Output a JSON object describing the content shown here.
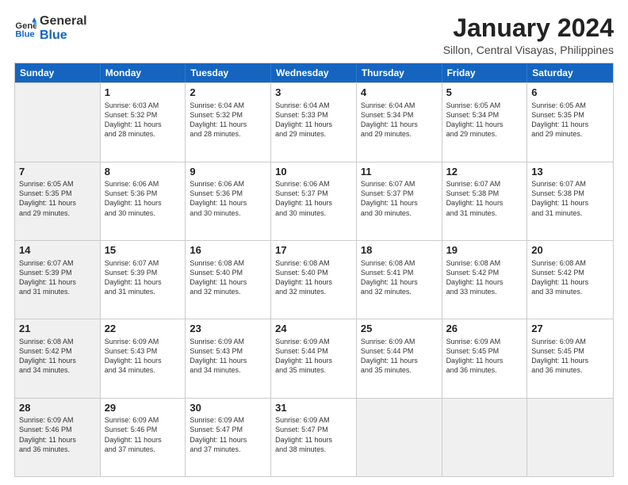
{
  "logo": {
    "text_general": "General",
    "text_blue": "Blue"
  },
  "header": {
    "title": "January 2024",
    "subtitle": "Sillon, Central Visayas, Philippines"
  },
  "weekdays": [
    "Sunday",
    "Monday",
    "Tuesday",
    "Wednesday",
    "Thursday",
    "Friday",
    "Saturday"
  ],
  "rows": [
    [
      {
        "day": "",
        "lines": [],
        "shaded": true
      },
      {
        "day": "1",
        "lines": [
          "Sunrise: 6:03 AM",
          "Sunset: 5:32 PM",
          "Daylight: 11 hours",
          "and 28 minutes."
        ]
      },
      {
        "day": "2",
        "lines": [
          "Sunrise: 6:04 AM",
          "Sunset: 5:32 PM",
          "Daylight: 11 hours",
          "and 28 minutes."
        ]
      },
      {
        "day": "3",
        "lines": [
          "Sunrise: 6:04 AM",
          "Sunset: 5:33 PM",
          "Daylight: 11 hours",
          "and 29 minutes."
        ]
      },
      {
        "day": "4",
        "lines": [
          "Sunrise: 6:04 AM",
          "Sunset: 5:34 PM",
          "Daylight: 11 hours",
          "and 29 minutes."
        ]
      },
      {
        "day": "5",
        "lines": [
          "Sunrise: 6:05 AM",
          "Sunset: 5:34 PM",
          "Daylight: 11 hours",
          "and 29 minutes."
        ]
      },
      {
        "day": "6",
        "lines": [
          "Sunrise: 6:05 AM",
          "Sunset: 5:35 PM",
          "Daylight: 11 hours",
          "and 29 minutes."
        ]
      }
    ],
    [
      {
        "day": "7",
        "lines": [
          "Sunrise: 6:05 AM",
          "Sunset: 5:35 PM",
          "Daylight: 11 hours",
          "and 29 minutes."
        ],
        "shaded": true
      },
      {
        "day": "8",
        "lines": [
          "Sunrise: 6:06 AM",
          "Sunset: 5:36 PM",
          "Daylight: 11 hours",
          "and 30 minutes."
        ]
      },
      {
        "day": "9",
        "lines": [
          "Sunrise: 6:06 AM",
          "Sunset: 5:36 PM",
          "Daylight: 11 hours",
          "and 30 minutes."
        ]
      },
      {
        "day": "10",
        "lines": [
          "Sunrise: 6:06 AM",
          "Sunset: 5:37 PM",
          "Daylight: 11 hours",
          "and 30 minutes."
        ]
      },
      {
        "day": "11",
        "lines": [
          "Sunrise: 6:07 AM",
          "Sunset: 5:37 PM",
          "Daylight: 11 hours",
          "and 30 minutes."
        ]
      },
      {
        "day": "12",
        "lines": [
          "Sunrise: 6:07 AM",
          "Sunset: 5:38 PM",
          "Daylight: 11 hours",
          "and 31 minutes."
        ]
      },
      {
        "day": "13",
        "lines": [
          "Sunrise: 6:07 AM",
          "Sunset: 5:38 PM",
          "Daylight: 11 hours",
          "and 31 minutes."
        ]
      }
    ],
    [
      {
        "day": "14",
        "lines": [
          "Sunrise: 6:07 AM",
          "Sunset: 5:39 PM",
          "Daylight: 11 hours",
          "and 31 minutes."
        ],
        "shaded": true
      },
      {
        "day": "15",
        "lines": [
          "Sunrise: 6:07 AM",
          "Sunset: 5:39 PM",
          "Daylight: 11 hours",
          "and 31 minutes."
        ]
      },
      {
        "day": "16",
        "lines": [
          "Sunrise: 6:08 AM",
          "Sunset: 5:40 PM",
          "Daylight: 11 hours",
          "and 32 minutes."
        ]
      },
      {
        "day": "17",
        "lines": [
          "Sunrise: 6:08 AM",
          "Sunset: 5:40 PM",
          "Daylight: 11 hours",
          "and 32 minutes."
        ]
      },
      {
        "day": "18",
        "lines": [
          "Sunrise: 6:08 AM",
          "Sunset: 5:41 PM",
          "Daylight: 11 hours",
          "and 32 minutes."
        ]
      },
      {
        "day": "19",
        "lines": [
          "Sunrise: 6:08 AM",
          "Sunset: 5:42 PM",
          "Daylight: 11 hours",
          "and 33 minutes."
        ]
      },
      {
        "day": "20",
        "lines": [
          "Sunrise: 6:08 AM",
          "Sunset: 5:42 PM",
          "Daylight: 11 hours",
          "and 33 minutes."
        ]
      }
    ],
    [
      {
        "day": "21",
        "lines": [
          "Sunrise: 6:08 AM",
          "Sunset: 5:42 PM",
          "Daylight: 11 hours",
          "and 34 minutes."
        ],
        "shaded": true
      },
      {
        "day": "22",
        "lines": [
          "Sunrise: 6:09 AM",
          "Sunset: 5:43 PM",
          "Daylight: 11 hours",
          "and 34 minutes."
        ]
      },
      {
        "day": "23",
        "lines": [
          "Sunrise: 6:09 AM",
          "Sunset: 5:43 PM",
          "Daylight: 11 hours",
          "and 34 minutes."
        ]
      },
      {
        "day": "24",
        "lines": [
          "Sunrise: 6:09 AM",
          "Sunset: 5:44 PM",
          "Daylight: 11 hours",
          "and 35 minutes."
        ]
      },
      {
        "day": "25",
        "lines": [
          "Sunrise: 6:09 AM",
          "Sunset: 5:44 PM",
          "Daylight: 11 hours",
          "and 35 minutes."
        ]
      },
      {
        "day": "26",
        "lines": [
          "Sunrise: 6:09 AM",
          "Sunset: 5:45 PM",
          "Daylight: 11 hours",
          "and 36 minutes."
        ]
      },
      {
        "day": "27",
        "lines": [
          "Sunrise: 6:09 AM",
          "Sunset: 5:45 PM",
          "Daylight: 11 hours",
          "and 36 minutes."
        ]
      }
    ],
    [
      {
        "day": "28",
        "lines": [
          "Sunrise: 6:09 AM",
          "Sunset: 5:46 PM",
          "Daylight: 11 hours",
          "and 36 minutes."
        ],
        "shaded": true
      },
      {
        "day": "29",
        "lines": [
          "Sunrise: 6:09 AM",
          "Sunset: 5:46 PM",
          "Daylight: 11 hours",
          "and 37 minutes."
        ]
      },
      {
        "day": "30",
        "lines": [
          "Sunrise: 6:09 AM",
          "Sunset: 5:47 PM",
          "Daylight: 11 hours",
          "and 37 minutes."
        ]
      },
      {
        "day": "31",
        "lines": [
          "Sunrise: 6:09 AM",
          "Sunset: 5:47 PM",
          "Daylight: 11 hours",
          "and 38 minutes."
        ]
      },
      {
        "day": "",
        "lines": [],
        "shaded": true
      },
      {
        "day": "",
        "lines": [],
        "shaded": true
      },
      {
        "day": "",
        "lines": [],
        "shaded": true
      }
    ]
  ]
}
